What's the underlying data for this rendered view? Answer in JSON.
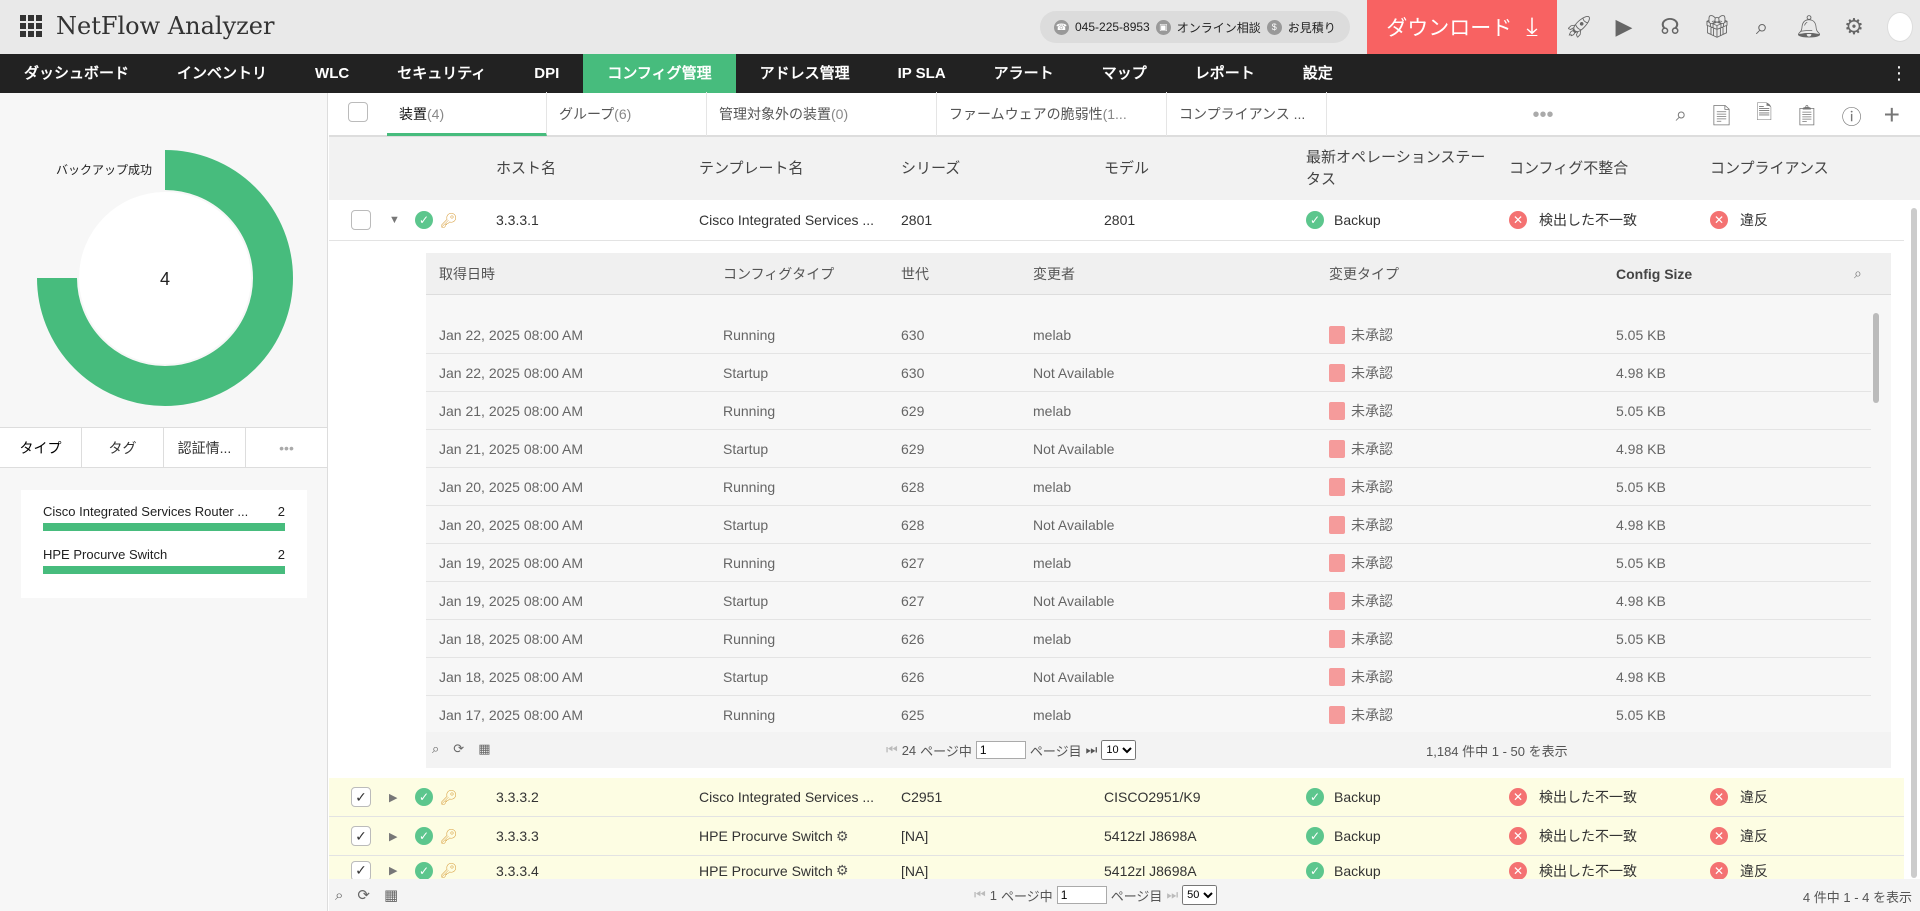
{
  "header": {
    "app_title": "NetFlow Analyzer",
    "phone": "045-225-8953",
    "online": "オンライン相談",
    "quote": "お見積り",
    "download": "ダウンロード",
    "icons": [
      "rocket-icon",
      "presentation-icon",
      "headset-icon",
      "gift-icon",
      "search-icon",
      "bell-icon",
      "gear-icon"
    ]
  },
  "nav": {
    "items": [
      "ダッシュボード",
      "インベントリ",
      "WLC",
      "セキュリティ",
      "DPI",
      "コンフィグ管理",
      "アドレス管理",
      "IP SLA",
      "アラート",
      "マップ",
      "レポート",
      "設定"
    ],
    "active": 5
  },
  "left": {
    "donut_label": "バックアップ成功",
    "donut_value": "4",
    "donut_color": "#47bc7d",
    "tabs": [
      "タイプ",
      "タグ",
      "認証情..."
    ],
    "types": [
      {
        "name": "Cisco Integrated Services Router ...",
        "count": "2"
      },
      {
        "name": "HPE Procurve Switch",
        "count": "2"
      }
    ]
  },
  "tabs": [
    {
      "label": "装置",
      "count": "(4)"
    },
    {
      "label": "グループ",
      "count": "(6)"
    },
    {
      "label": "管理対象外の装置",
      "count": "(0)"
    },
    {
      "label": "ファームウェアの脆弱性",
      "count": "(1..."
    },
    {
      "label": "コンプライアンス ...",
      "count": ""
    }
  ],
  "columns": [
    "ホスト名",
    "テンプレート名",
    "シリーズ",
    "モデル",
    "最新オペレーションステータス",
    "コンフィグ不整合",
    "コンプライアンス"
  ],
  "devices": [
    {
      "checked": false,
      "expanded": true,
      "host": "3.3.3.1",
      "template": "Cisco Integrated Services ...",
      "series": "2801",
      "model": "2801",
      "status": "Backup",
      "mismatch": "検出した不一致",
      "compliance": "違反"
    },
    {
      "checked": true,
      "expanded": false,
      "host": "3.3.3.2",
      "template": "Cisco Integrated Services ...",
      "series": "C2951",
      "model": "CISCO2951/K9",
      "status": "Backup",
      "mismatch": "検出した不一致",
      "compliance": "違反"
    },
    {
      "checked": true,
      "expanded": false,
      "host": "3.3.3.3",
      "template": "HPE Procurve Switch",
      "series": "[NA]",
      "model": "5412zl J8698A",
      "status": "Backup",
      "mismatch": "検出した不一致",
      "compliance": "違反"
    },
    {
      "checked": true,
      "expanded": false,
      "host": "3.3.3.4",
      "template": "HPE Procurve Switch",
      "series": "[NA]",
      "model": "5412zl J8698A",
      "status": "Backup",
      "mismatch": "検出した不一致",
      "compliance": "違反"
    }
  ],
  "nested": {
    "columns": [
      "取得日時",
      "コンフィグタイプ",
      "世代",
      "変更者",
      "変更タイプ",
      "Config Size"
    ],
    "rows": [
      [
        "Jan 22, 2025 08:00 AM",
        "Running",
        "630",
        "melab",
        "未承認",
        "5.05 KB"
      ],
      [
        "Jan 22, 2025 08:00 AM",
        "Startup",
        "630",
        "Not Available",
        "未承認",
        "4.98 KB"
      ],
      [
        "Jan 21, 2025 08:00 AM",
        "Running",
        "629",
        "melab",
        "未承認",
        "5.05 KB"
      ],
      [
        "Jan 21, 2025 08:00 AM",
        "Startup",
        "629",
        "Not Available",
        "未承認",
        "4.98 KB"
      ],
      [
        "Jan 20, 2025 08:00 AM",
        "Running",
        "628",
        "melab",
        "未承認",
        "5.05 KB"
      ],
      [
        "Jan 20, 2025 08:00 AM",
        "Startup",
        "628",
        "Not Available",
        "未承認",
        "4.98 KB"
      ],
      [
        "Jan 19, 2025 08:00 AM",
        "Running",
        "627",
        "melab",
        "未承認",
        "5.05 KB"
      ],
      [
        "Jan 19, 2025 08:00 AM",
        "Startup",
        "627",
        "Not Available",
        "未承認",
        "4.98 KB"
      ],
      [
        "Jan 18, 2025 08:00 AM",
        "Running",
        "626",
        "melab",
        "未承認",
        "5.05 KB"
      ],
      [
        "Jan 18, 2025 08:00 AM",
        "Startup",
        "626",
        "Not Available",
        "未承認",
        "4.98 KB"
      ],
      [
        "Jan 17, 2025 08:00 AM",
        "Running",
        "625",
        "melab",
        "未承認",
        "5.05 KB"
      ]
    ],
    "pager": {
      "total_pages": "24",
      "of_label": "ページ中",
      "page": "1",
      "page_label": "ページ目",
      "per_page": "10",
      "summary": "1,184 件中 1 - 50 を表示"
    }
  },
  "pager": {
    "total_pages": "1",
    "of_label": "ページ中",
    "page": "1",
    "page_label": "ページ目",
    "per_page": "50",
    "summary": "4 件中 1 - 4 を表示"
  }
}
